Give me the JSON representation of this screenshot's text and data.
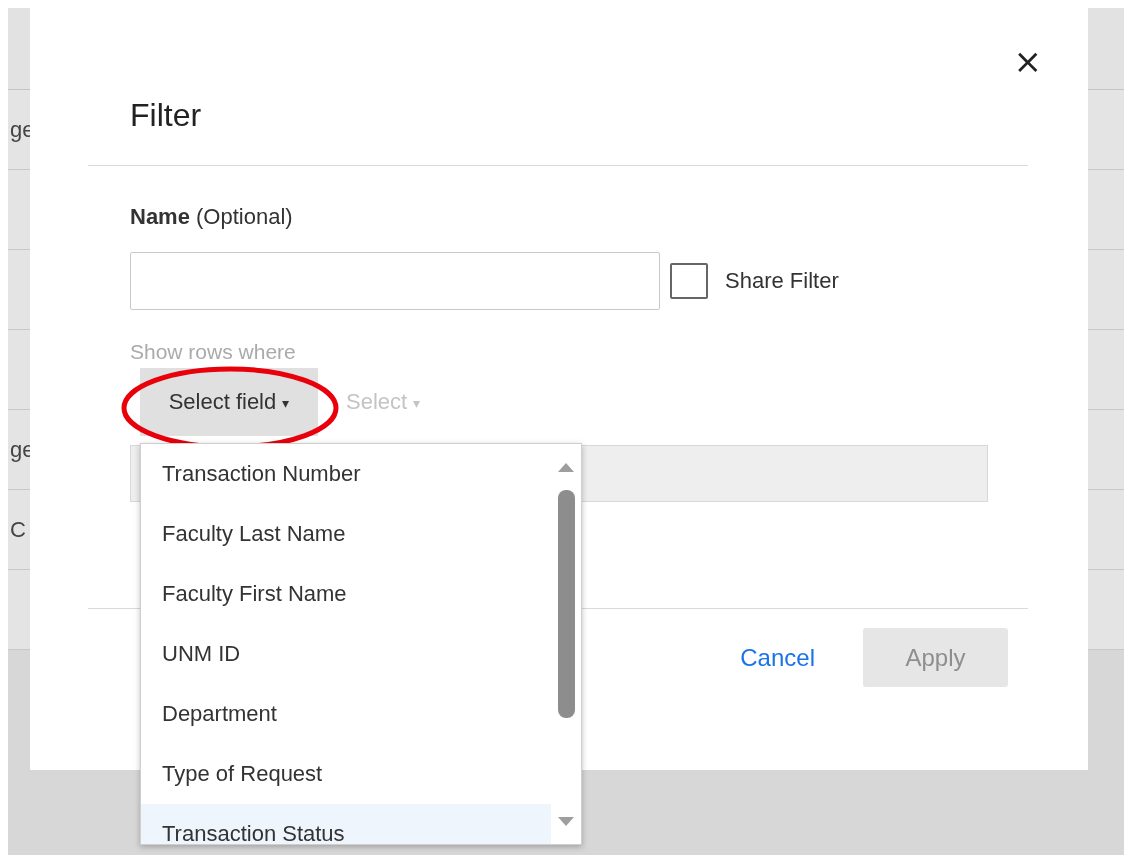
{
  "background_rows": [
    {
      "text": "ge"
    },
    {},
    {},
    {},
    {
      "text": "ge"
    },
    {
      "text": "C"
    },
    {}
  ],
  "dialog": {
    "title": "Filter",
    "close": "×",
    "name_label": "**Name** (Optional)",
    "share_filter": {
      "label": "Share Filter",
      "checked": false
    },
    "show_rows_label": "Show rows where",
    "field_select": {
      "label": "Select field",
      "caret": "▾"
    },
    "operator_select": {
      "label": "Select",
      "caret": "▾",
      "disabled": true
    },
    "cancel": "Cancel",
    "apply": {
      "label": "Apply",
      "disabled": true
    }
  },
  "dropdown": {
    "items": [
      {
        "label": "Transaction Number",
        "highlighted": false
      },
      {
        "label": "Faculty Last Name",
        "highlighted": false
      },
      {
        "label": "Faculty First Name",
        "highlighted": false
      },
      {
        "label": "UNM ID",
        "highlighted": false
      },
      {
        "label": "Department",
        "highlighted": false
      },
      {
        "label": "Type of Request",
        "highlighted": false
      },
      {
        "label": "Transaction Status",
        "highlighted": true
      }
    ]
  }
}
